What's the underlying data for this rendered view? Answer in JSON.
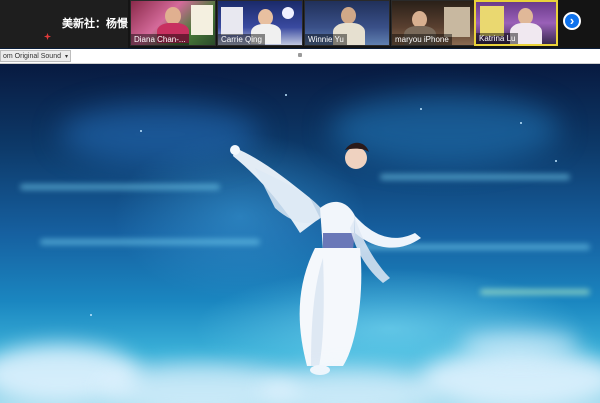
{
  "presenter": {
    "name": "美新社：杨憬"
  },
  "participants": [
    {
      "name": "Diana Chan-..."
    },
    {
      "name": "Carrie Qing"
    },
    {
      "name": "Winnie Yu"
    },
    {
      "name": "maryou iPhone"
    },
    {
      "name": "Katrina Lu"
    }
  ],
  "controls": {
    "original_sound": "om Original Sound",
    "next_icon": "chevron-right-icon",
    "dropdown_icon": "chevron-down-icon"
  },
  "colors": {
    "accent": "#0e72ed",
    "active_speaker": "#e9d23a"
  }
}
